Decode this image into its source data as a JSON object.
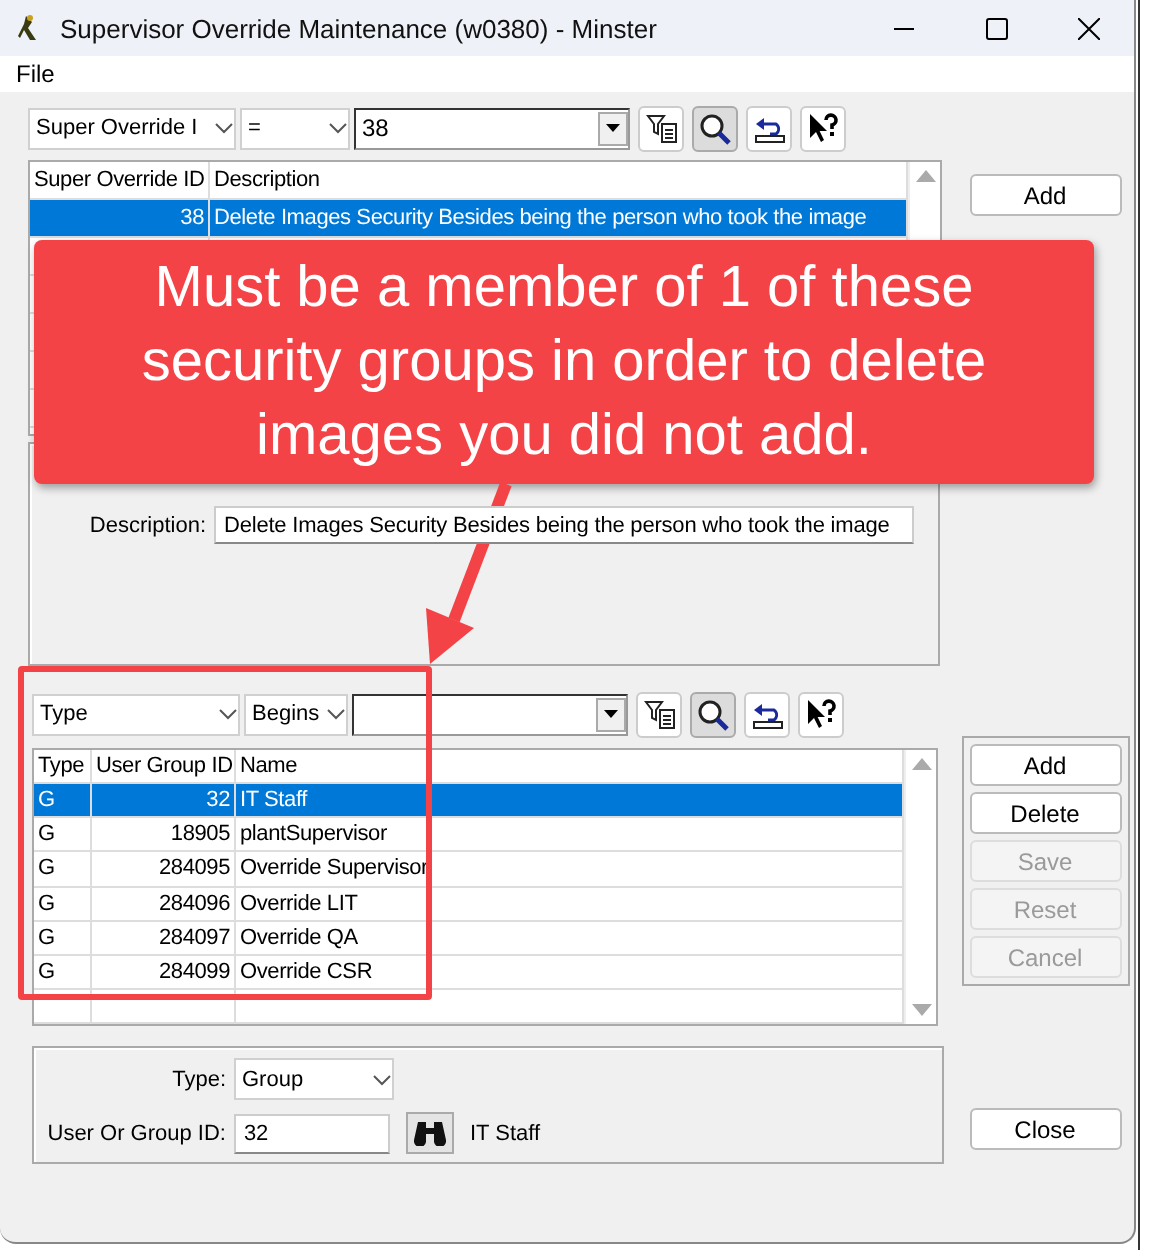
{
  "window": {
    "title": "Supervisor Override Maintenance (w0380) - Minster"
  },
  "menu": [
    "File"
  ],
  "top_filter": {
    "field": "Super Override I",
    "operator": "=",
    "value": "38"
  },
  "top_table": {
    "columns": [
      "Super Override ID",
      "Description"
    ],
    "rows": [
      {
        "cells": [
          "38",
          "Delete Images Security Besides being the person who took the image"
        ],
        "selected": true
      }
    ]
  },
  "top_buttons": [
    {
      "label": "Add",
      "disabled": false
    }
  ],
  "details": {
    "label": "Description:",
    "value": "Delete Images Security Besides being the person who took the image"
  },
  "lower_filter": {
    "field": "Type",
    "operator": "Begins"
  },
  "lower_table": {
    "columns": [
      "Type",
      "User Group ID",
      "Name"
    ],
    "rows": [
      {
        "cells": [
          "G",
          "32",
          "IT Staff"
        ],
        "selected": true
      },
      {
        "cells": [
          "G",
          "18905",
          "plantSupervisor"
        ],
        "selected": false
      },
      {
        "cells": [
          "G",
          "284095",
          "Override Supervisor"
        ],
        "selected": false
      },
      {
        "cells": [
          "G",
          "284096",
          "Override LIT"
        ],
        "selected": false
      },
      {
        "cells": [
          "G",
          "284097",
          "Override QA"
        ],
        "selected": false
      },
      {
        "cells": [
          "G",
          "284099",
          "Override CSR"
        ],
        "selected": false
      }
    ]
  },
  "lower_buttons": [
    {
      "label": "Add",
      "disabled": false
    },
    {
      "label": "Delete",
      "disabled": false
    },
    {
      "label": "Save",
      "disabled": true
    },
    {
      "label": "Reset",
      "disabled": true
    },
    {
      "label": "Cancel",
      "disabled": true
    }
  ],
  "entry": {
    "type_label": "Type:",
    "type": "Group",
    "id_label": "User Or Group ID:",
    "id": "32",
    "name": "IT Staff"
  },
  "close_button": "Close",
  "callout": {
    "text": "Must be a member of 1 of these security groups in order to delete images you did not add."
  }
}
